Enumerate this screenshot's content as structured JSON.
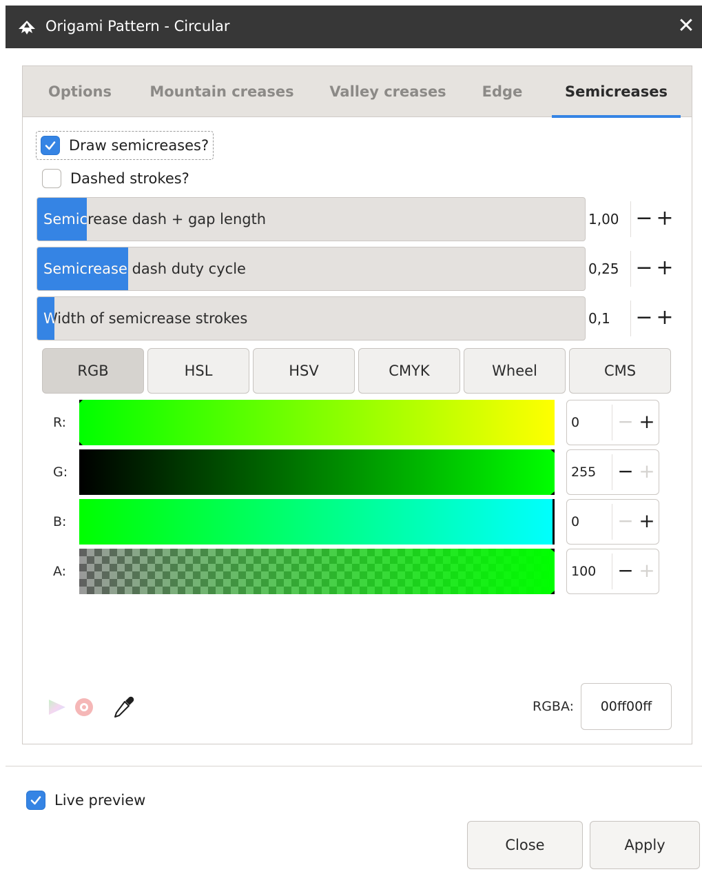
{
  "window": {
    "title": "Origami Pattern - Circular",
    "close_glyph": "✕"
  },
  "tabs": [
    {
      "label": "Options"
    },
    {
      "label": "Mountain creases"
    },
    {
      "label": "Valley creases"
    },
    {
      "label": "Edge"
    },
    {
      "label": "Semicreases",
      "active": true
    }
  ],
  "options": {
    "draw_semicreases": {
      "label": "Draw semicreases?",
      "checked": true
    },
    "dashed_strokes": {
      "label": "Dashed strokes?",
      "checked": false
    }
  },
  "spinners": [
    {
      "label": "Semicrease dash + gap length",
      "value": "1,00",
      "fraction": 0.09
    },
    {
      "label": "Semicrease dash duty cycle",
      "value": "0,25",
      "fraction": 0.166
    },
    {
      "label": "Width of semicrease strokes",
      "value": "0,1",
      "fraction": 0.032
    }
  ],
  "spin_glyphs": {
    "minus": "−",
    "plus": "+"
  },
  "color_modes": [
    "RGB",
    "HSL",
    "HSV",
    "CMYK",
    "Wheel",
    "CMS"
  ],
  "active_color_mode": "RGB",
  "channels": [
    {
      "label": "R:",
      "value": "0"
    },
    {
      "label": "G:",
      "value": "255"
    },
    {
      "label": "B:",
      "value": "0"
    },
    {
      "label": "A:",
      "value": "100"
    }
  ],
  "rgba": {
    "label": "RGBA:",
    "value": "00ff00ff"
  },
  "live_preview": {
    "label": "Live preview",
    "checked": true
  },
  "buttons": {
    "close": "Close",
    "apply": "Apply"
  },
  "colors": {
    "accent": "#3584e4",
    "current_color": "#00ff00"
  }
}
